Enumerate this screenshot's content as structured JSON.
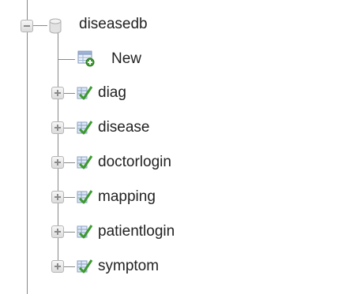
{
  "database": {
    "name": "diseasedb",
    "new_label": "New"
  },
  "tables": [
    {
      "name": "diag"
    },
    {
      "name": "disease"
    },
    {
      "name": "doctorlogin"
    },
    {
      "name": "mapping"
    },
    {
      "name": "patientlogin"
    },
    {
      "name": "symptom"
    }
  ],
  "colors": {
    "line": "#888888",
    "text": "#222222",
    "icon_green": "#3c9a2f"
  }
}
